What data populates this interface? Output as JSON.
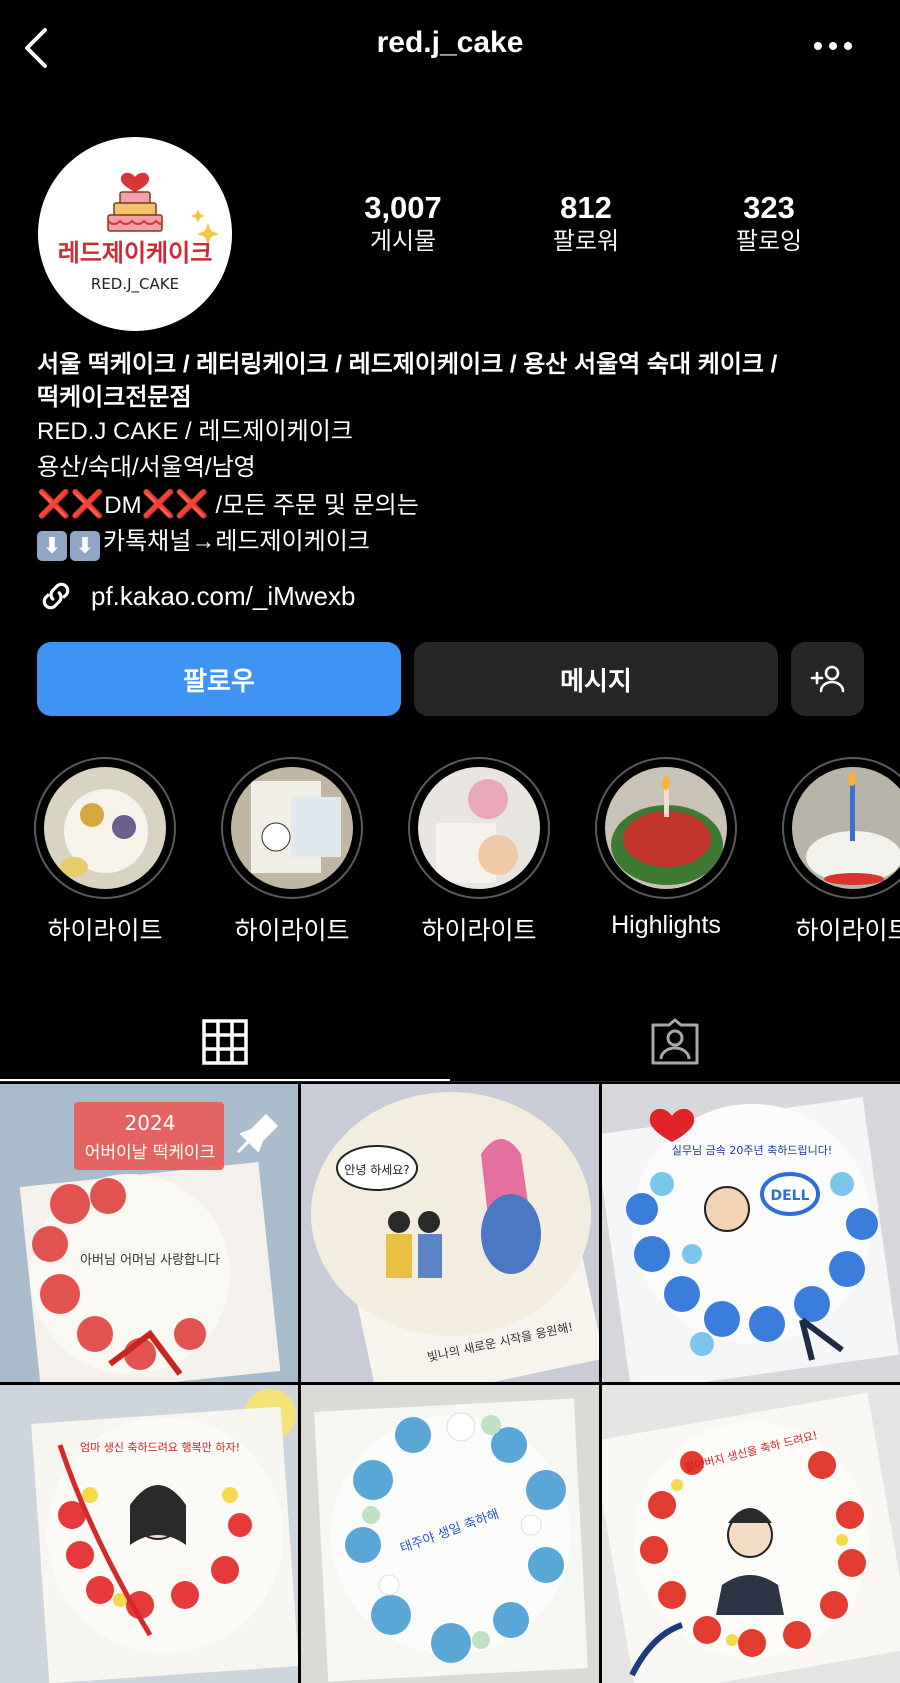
{
  "header": {
    "username": "red.j_cake",
    "back_icon": "chevron-left-icon",
    "more_icon": "more-horizontal-icon"
  },
  "profile": {
    "avatar": {
      "brand_korean": "레드제이케이크",
      "brand_english": "RED.J_CAKE"
    },
    "stats": [
      {
        "value": "3,007",
        "label": "게시물"
      },
      {
        "value": "812",
        "label": "팔로워"
      },
      {
        "value": "323",
        "label": "팔로잉"
      }
    ]
  },
  "bio": {
    "category_line1": "서울 떡케이크 / 레터링케이크 /  레드제이케이크 / 용산 서울역 숙대 케이크 /",
    "category_line2": "떡케이크전문점",
    "name_line": "RED.J CAKE / 레드제이케이크",
    "location_line": "용산/숙대/서울역/남영",
    "dm_prefix": "❌❌",
    "dm_text": "DM",
    "dm_suffix": "❌❌",
    "dm_tail": " /모든 주문 및 문의는",
    "kakao_arrows": [
      "⬇",
      "⬇"
    ],
    "kakao_text": "카톡채널→레드제이케이크",
    "link": "pf.kakao.com/_iMwexb",
    "link_icon": "link-icon"
  },
  "actions": {
    "follow": "팔로우",
    "message": "메시지",
    "add_user_icon": "add-person-icon"
  },
  "highlights": [
    {
      "label": "하이라이트"
    },
    {
      "label": "하이라이트"
    },
    {
      "label": "하이라이트"
    },
    {
      "label": "Highlights"
    },
    {
      "label": "하이라이트"
    }
  ],
  "tabs": [
    {
      "name": "grid",
      "icon": "grid-icon",
      "active": true
    },
    {
      "name": "tagged",
      "icon": "tagged-person-icon",
      "active": false
    }
  ],
  "posts": [
    {
      "text_top": "2024",
      "text_mid": "어버이날 떡케이크",
      "cake_text": "아버님 어머님 사랑합니다",
      "pinned": true,
      "pin_icon": "pin-icon"
    },
    {
      "cake_text": "안녕 하세요?",
      "caption": "빛나의 새로운 시작을 응원해!"
    },
    {
      "cake_text": "실무님 금속 20주년 축하드립니다!",
      "badge": "DELL"
    },
    {
      "cake_text": "엄마 생신 축하드려요 행복만 하자!"
    },
    {
      "cake_text": "태주야 생일 축하해"
    },
    {
      "cake_text": "할아버지 생신을 축하 드려요!"
    }
  ],
  "colors": {
    "background": "#000000",
    "follow_button": "#3f93f3",
    "secondary_button": "#262626",
    "x_mark": "#e0242a"
  }
}
